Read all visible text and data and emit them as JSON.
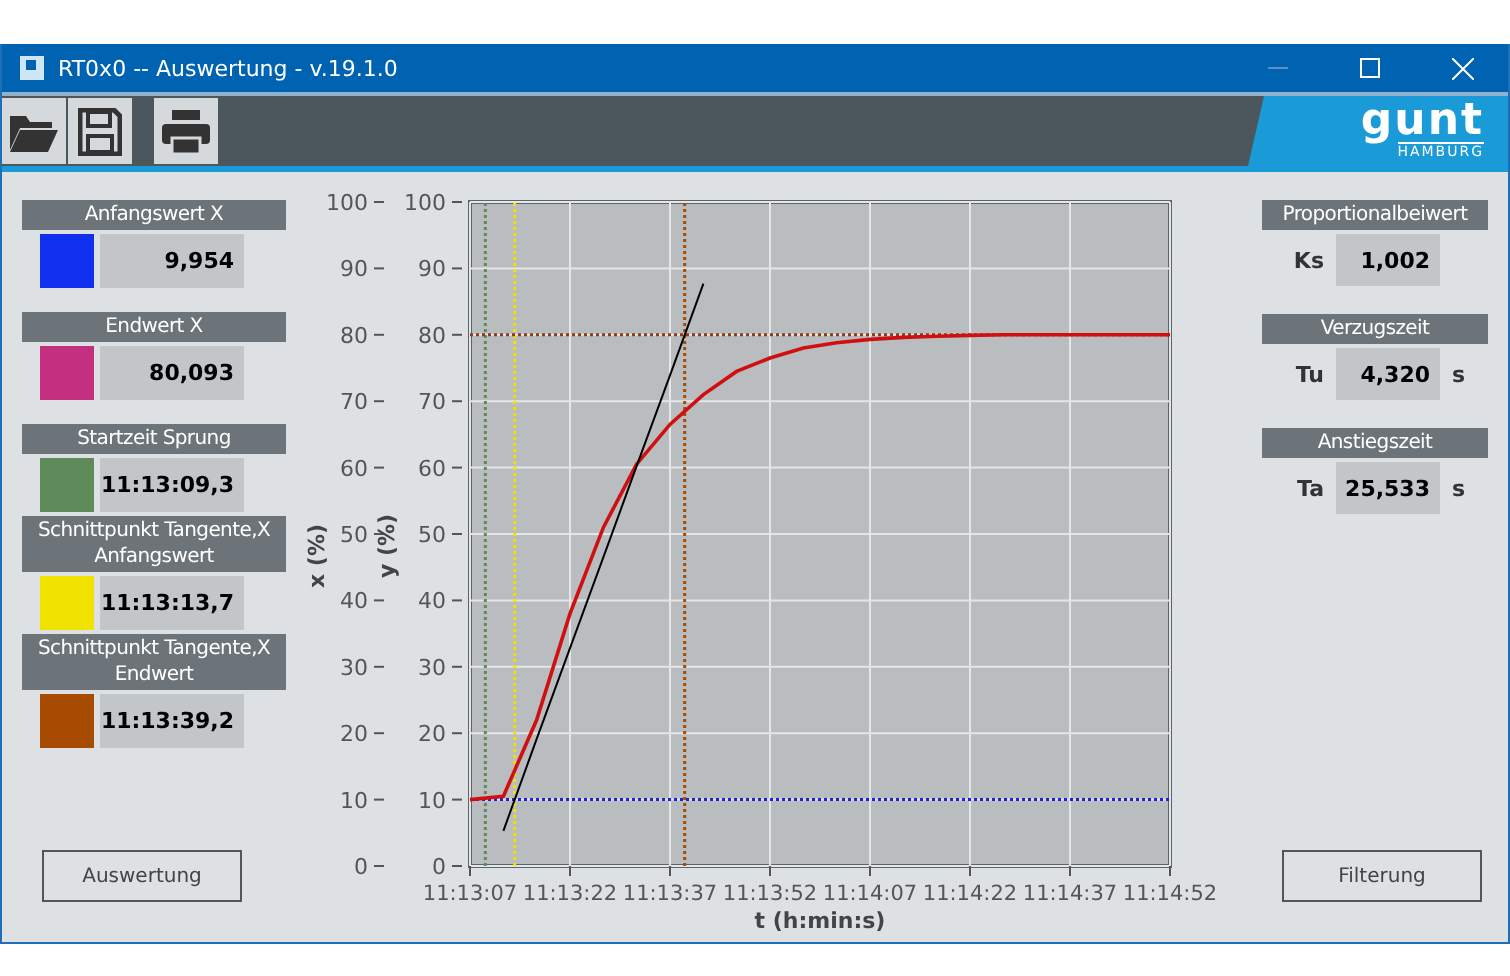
{
  "window": {
    "title": "RT0x0 -- Auswertung - v.19.1.0"
  },
  "toolbar": {
    "logo": {
      "text": "gunt",
      "subtext": "HAMBURG"
    }
  },
  "left_panel": {
    "fields": [
      {
        "label": "Anfangswert X",
        "color": "#1030f0",
        "value": "9,954"
      },
      {
        "label": "Endwert X",
        "color": "#c2307f",
        "value": "80,093"
      },
      {
        "label": "Startzeit Sprung",
        "color": "#5f8a5a",
        "value": "11:13:09,3"
      },
      {
        "label": "Schnittpunkt Tangente,X Anfangswert",
        "color": "#f2e200",
        "value": "11:13:13,7"
      },
      {
        "label": "Schnittpunkt Tangente,X Endwert",
        "color": "#a64b00",
        "value": "11:13:39,2"
      }
    ],
    "button": "Auswertung"
  },
  "chart": {
    "outer_axis": {
      "label": "x (%)",
      "ticks": [
        "100",
        "90",
        "80",
        "70",
        "60",
        "50",
        "40",
        "30",
        "20",
        "10",
        "0"
      ]
    },
    "chart_data": {
      "type": "line",
      "xlabel": "t (h:min:s)",
      "ylabel": "y (%)",
      "categories": [
        "11:13:07",
        null,
        null,
        "11:13:22",
        null,
        null,
        "11:13:37",
        null,
        null,
        "11:13:52",
        null,
        null,
        "11:14:07",
        null,
        null,
        "11:14:22",
        null,
        null,
        "11:14:37",
        null,
        null,
        "11:14:52"
      ],
      "series": [
        {
          "color": "#d01010",
          "values": [
            10,
            10.5,
            22,
            38,
            51,
            60.5,
            66.5,
            71,
            74.5,
            76.5,
            78,
            78.8,
            79.3,
            79.6,
            79.8,
            79.9,
            80,
            80,
            80,
            80,
            80,
            80
          ]
        },
        {
          "color": "#000000",
          "values": [
            null,
            5.3,
            19.1,
            32.8,
            46.5,
            60.2,
            73.9,
            87.7,
            null,
            null,
            null,
            null,
            null,
            null,
            null,
            null,
            null,
            null,
            null,
            null,
            null,
            null
          ]
        },
        {
          "color": "#2020d0",
          "line_style": "dotted",
          "values": [
            10,
            10,
            10,
            10,
            10,
            10,
            10,
            10,
            10,
            10,
            10,
            10,
            10,
            10,
            10,
            10,
            10,
            10,
            10,
            10,
            10,
            10
          ]
        },
        {
          "color": "#8b3a1a",
          "line_style": "dotted",
          "values": [
            80,
            80,
            80,
            80,
            80,
            80,
            80,
            80,
            80,
            80,
            80,
            80,
            80,
            80,
            80,
            80,
            80,
            80,
            80,
            80,
            80,
            80
          ]
        }
      ],
      "grid": true,
      "ylim": [
        0,
        100
      ],
      "yticks": [
        0,
        10,
        20,
        30,
        40,
        50,
        60,
        70,
        80,
        90,
        100
      ]
    }
  },
  "right_panel": {
    "fields": [
      {
        "label": "Proportionalbeiwert",
        "symbol": "Ks",
        "value": "1,002"
      },
      {
        "label": "Verzugszeit",
        "symbol": "Tu",
        "value": "4,320",
        "unit": "s"
      },
      {
        "label": "Anstiegszeit",
        "symbol": "Ta",
        "value": "25,533",
        "unit": "s"
      }
    ],
    "button": "Filterung"
  }
}
